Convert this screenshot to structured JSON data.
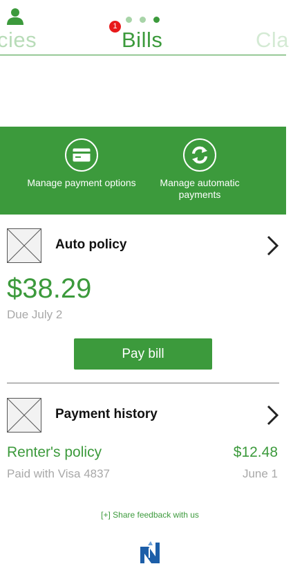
{
  "header": {
    "user_icon": "user-icon",
    "tabs": [
      "cies",
      "Bills",
      "Cla"
    ],
    "active_tab": "Bills",
    "badge_count": "1",
    "page_dots": 3
  },
  "actions": [
    {
      "label": "Manage payment options",
      "icon": "credit-card-icon"
    },
    {
      "label": "Manage automatic payments",
      "icon": "refresh-icon"
    }
  ],
  "auto_policy": {
    "title": "Auto policy",
    "amount": "$38.29",
    "due": "Due July 2",
    "pay_label": "Pay bill"
  },
  "payment_history": {
    "title": "Payment history",
    "entry_name": "Renter's policy",
    "entry_amount": "$12.48",
    "entry_method": "Paid with Visa 4837",
    "entry_date": "June 1"
  },
  "footer": {
    "feedback": "[+] Share feedback with us",
    "logo": "company-logo"
  },
  "colors": {
    "brand_green": "#3c9a3c",
    "badge_red": "#e8191a"
  }
}
